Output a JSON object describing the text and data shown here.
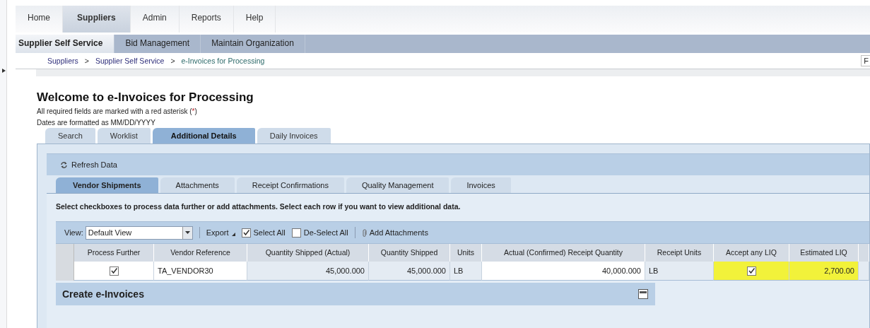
{
  "top_nav": [
    {
      "label": "Home",
      "selected": false
    },
    {
      "label": "Suppliers",
      "selected": true
    },
    {
      "label": "Admin",
      "selected": false
    },
    {
      "label": "Reports",
      "selected": false
    },
    {
      "label": "Help",
      "selected": false
    }
  ],
  "sub_nav": [
    {
      "label": "Supplier Self Service",
      "selected": true
    },
    {
      "label": "Bid Management",
      "selected": false
    },
    {
      "label": "Maintain Organization",
      "selected": false
    }
  ],
  "breadcrumb": [
    {
      "kind": "link",
      "text": "Suppliers"
    },
    {
      "kind": "separator",
      "text": ">"
    },
    {
      "kind": "link",
      "text": "Supplier Self Service"
    },
    {
      "kind": "separator",
      "text": ">"
    },
    {
      "kind": "current",
      "text": "e-Invoices for Processing"
    }
  ],
  "corner_button": "F",
  "heading": "Welcome to e-Invoices for Processing",
  "required_note": {
    "before": "All required fields are marked with a red asterisk (",
    "mark": "*",
    "after": ")"
  },
  "date_note": "Dates are formatted as MM/DD/YYYY",
  "tabs": [
    {
      "label": "Search",
      "selected": false
    },
    {
      "label": "Worklist",
      "selected": false
    },
    {
      "label": "Additional Details",
      "selected": true
    },
    {
      "label": "Daily Invoices",
      "selected": false
    }
  ],
  "refresh_button": "Refresh Data",
  "inner_tabs": [
    {
      "label": "Vendor Shipments",
      "selected": true
    },
    {
      "label": "Attachments",
      "selected": false
    },
    {
      "label": "Receipt Confirmations",
      "selected": false
    },
    {
      "label": "Quality Management",
      "selected": false
    },
    {
      "label": "Invoices",
      "selected": false
    }
  ],
  "instruction": "Select checkboxes to process data further or add attachments. Select each row if you want to view additional data.",
  "toolbar": {
    "view_label": "View:",
    "view_value": "Default View",
    "export": "Export",
    "select_all": {
      "label": "Select All",
      "checked": true
    },
    "deselect_all": {
      "label": "De-Select All",
      "checked": false
    },
    "add_attachments": "Add Attachments"
  },
  "table": {
    "columns": [
      {
        "label": "Process Further",
        "kind": "check"
      },
      {
        "label": "Vendor Reference",
        "kind": "text"
      },
      {
        "label": "Quantity Shipped (Actual)",
        "kind": "number"
      },
      {
        "label": "Quantity Shipped",
        "kind": "number"
      },
      {
        "label": "Units",
        "kind": "text"
      },
      {
        "label": "Actual (Confirmed) Receipt Quantity",
        "kind": "number"
      },
      {
        "label": "Receipt Units",
        "kind": "text"
      },
      {
        "label": "Accept any LIQ",
        "kind": "check"
      },
      {
        "label": "Estimated LIQ",
        "kind": "number"
      }
    ],
    "rows": [
      {
        "selected": false,
        "cells": [
          {
            "checked": true,
            "highlighted": false
          },
          {
            "text": "TA_VENDOR30",
            "highlighted": false
          },
          {
            "text": "45,000.000",
            "highlighted": false
          },
          {
            "text": "45,000.000",
            "highlighted": false
          },
          {
            "text": "LB",
            "highlighted": false
          },
          {
            "text": "40,000.000",
            "highlighted": false
          },
          {
            "text": "LB",
            "highlighted": false
          },
          {
            "checked": true,
            "highlighted": true
          },
          {
            "text": "2,700.00",
            "highlighted": true
          }
        ]
      }
    ]
  },
  "section": {
    "title": "Create e-Invoices",
    "expanded": true
  }
}
